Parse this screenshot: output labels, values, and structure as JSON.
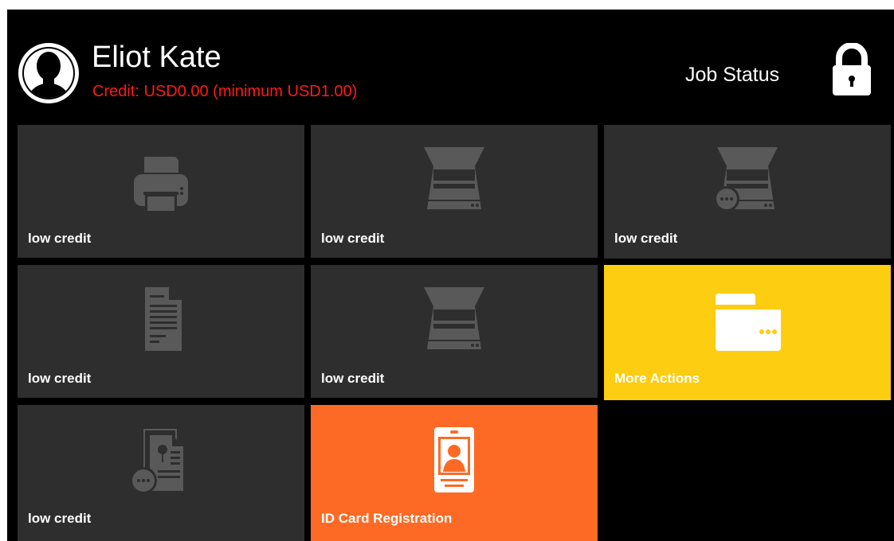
{
  "header": {
    "user_name": "Eliot Kate",
    "credit_text": "Credit: USD0.00 (minimum USD1.00)",
    "credit_color": "#ff1a1a",
    "job_status_label": "Job Status",
    "avatar_icon": "user-avatar-icon",
    "lock_icon": "lock-icon"
  },
  "colors": {
    "background": "#000000",
    "tile_disabled": "#2e2e2e",
    "icon_disabled": "#595959",
    "more_actions": "#fdcd12",
    "id_card": "#fd6a25"
  },
  "tiles": [
    {
      "label": "low credit",
      "icon": "printer-icon",
      "enabled": false
    },
    {
      "label": "low credit",
      "icon": "scanner-icon",
      "enabled": false
    },
    {
      "label": "low credit",
      "icon": "scanner-more-icon",
      "enabled": false
    },
    {
      "label": "low credit",
      "icon": "document-icon",
      "enabled": false
    },
    {
      "label": "low credit",
      "icon": "scanner-icon",
      "enabled": false
    },
    {
      "label": "More Actions",
      "icon": "folder-more-icon",
      "enabled": true
    },
    {
      "label": "low credit",
      "icon": "copy-more-icon",
      "enabled": false
    },
    {
      "label": "ID Card Registration",
      "icon": "id-card-icon",
      "enabled": true
    }
  ]
}
